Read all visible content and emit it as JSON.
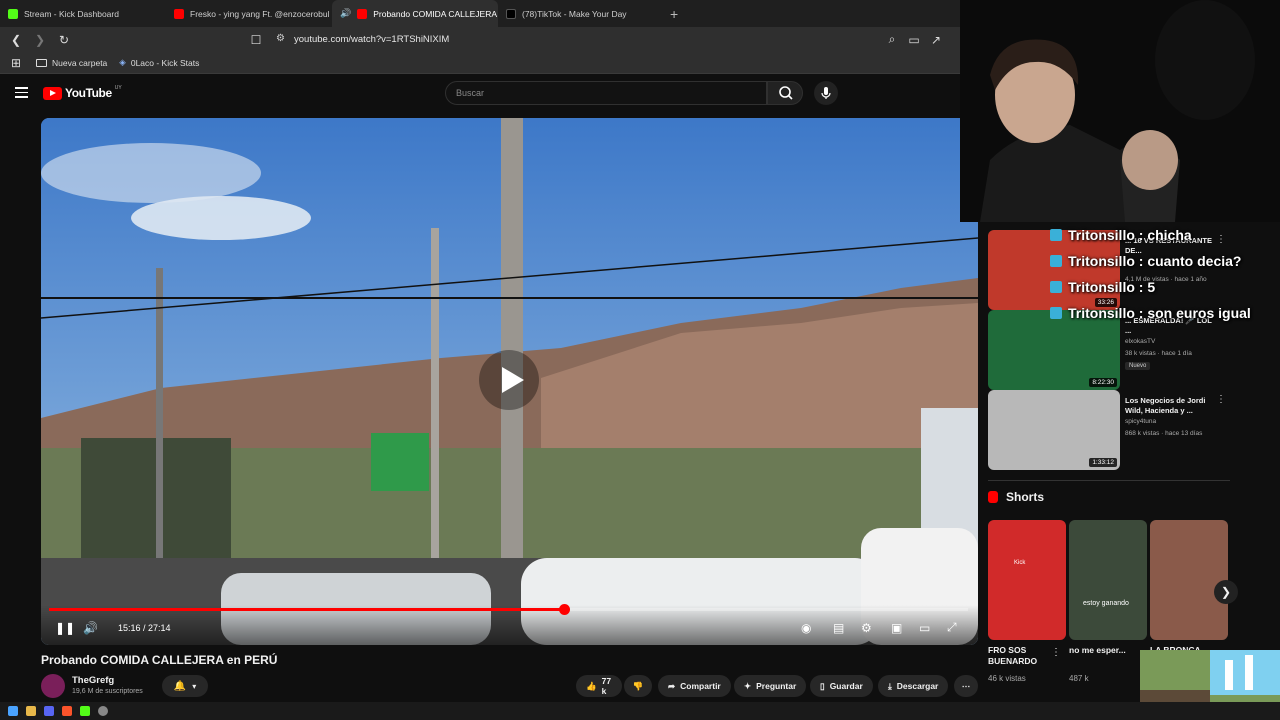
{
  "browser": {
    "tabs": [
      {
        "label": "Stream - Kick Dashboard",
        "color": "#53fc18"
      },
      {
        "label": "Fresko - ying yang Ft. @enzocerobul",
        "color": "#ff0000"
      },
      {
        "label": "Probando COMIDA CALLEJERA",
        "color": "#ff0000",
        "active": true
      },
      {
        "label": "(78)TikTok - Make Your Day",
        "color": "#111111"
      }
    ],
    "url": "youtube.com/watch?v=1RTShiNIXIM",
    "bookmarks": [
      "Nueva carpeta",
      "0Laco - Kick Stats"
    ]
  },
  "youtube": {
    "logo": "YouTube",
    "region": "UY",
    "search_placeholder": "Buscar"
  },
  "player": {
    "time": "15:16 / 27:14",
    "progress": 0.56
  },
  "video": {
    "title": "Probando COMIDA CALLEJERA en PERÚ",
    "channel": "TheGrefg",
    "subs": "19,6 M de suscriptores",
    "likes": "77 k",
    "actions": [
      "Compartir",
      "Preguntar",
      "Guardar",
      "Descargar"
    ]
  },
  "sidebar_videos": [
    {
      "title": "... 16 VS RESTAURANTE DE...",
      "channel": "",
      "meta": "4,1 M de vistas · hace 1 año",
      "duration": "33:26",
      "color": "#c0392b"
    },
    {
      "title": "... ESMERALDA! 🎤 LOL ...",
      "channel": "elxokasTV",
      "meta": "38 k vistas · hace 1 día",
      "duration": "8:22:30",
      "badge": "Nuevo",
      "color": "#1f6b3a"
    },
    {
      "title": "Los Negocios de Jordi Wild, Hacienda y ...",
      "channel": "spicy4tuna",
      "meta": "868 k vistas · hace 13 días",
      "duration": "1:33:12",
      "color": "#b8b8b8"
    }
  ],
  "chat_overlay": [
    "Tritonsillo : chicha",
    "Tritonsillo : cuanto decia?",
    "Tritonsillo : 5",
    "Tritonsillo : son euros igual"
  ],
  "shorts": {
    "heading": "Shorts",
    "items": [
      {
        "title": "FRO SOS BUENARDO",
        "views": "46 k vistas",
        "caption": "Kick",
        "color": "#d12a2a"
      },
      {
        "title": "no me esper...",
        "views": "487 k",
        "caption": "estoy ganando",
        "color": "#3c4a3a"
      },
      {
        "title": "LA BRONCA ...",
        "views": "",
        "caption": "",
        "color": "#8a5a4a"
      }
    ]
  }
}
